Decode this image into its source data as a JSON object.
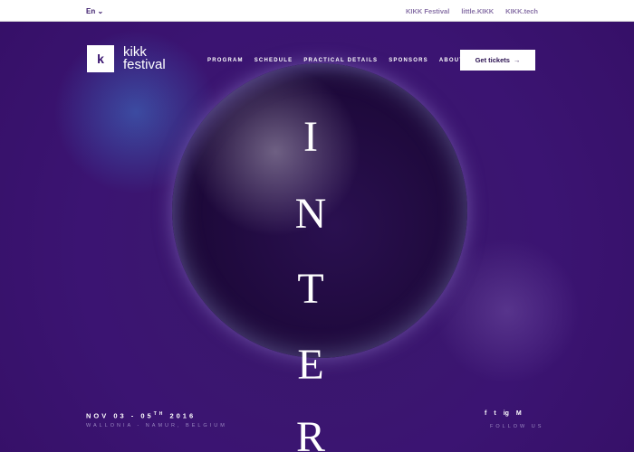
{
  "topbar": {
    "language": "En",
    "links": [
      "KIKK Festival",
      "little.KIKK",
      "KIKK.tech"
    ]
  },
  "logo": {
    "mark": "k",
    "line1": "kikk",
    "line2": "festival"
  },
  "nav": [
    "PROGRAM",
    "SCHEDULE",
    "PRACTICAL DETAILS",
    "SPONSORS",
    "ABOUT"
  ],
  "cta": {
    "label": "Get tickets",
    "arrow": "→"
  },
  "hero": {
    "letters": [
      "I",
      "N",
      "T",
      "E",
      "R"
    ]
  },
  "footer": {
    "date_prefix": "NOV 03 - 05",
    "date_sup": "TH",
    "year": "2016",
    "place": "WALLONIA - NAMUR, BELGIUM",
    "follow": "FOLLOW US",
    "social": [
      "f",
      "t",
      "ig",
      "M"
    ]
  }
}
